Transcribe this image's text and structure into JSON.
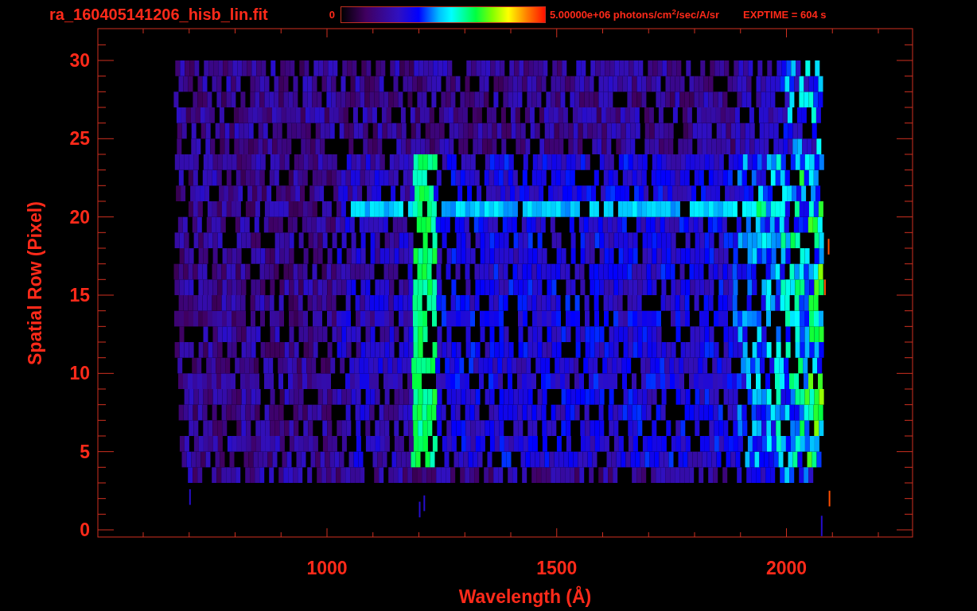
{
  "title": "ra_160405141206_hisb_lin.fit",
  "colorbar": {
    "min_label": "0",
    "max_label": "5.00000e+06 photons/cm$^{2}$/sec/A/sr"
  },
  "exposure": "EXPTIME = 604 s",
  "plot": {
    "xlabel": "Wavelength (Å)",
    "ylabel": "Spatial Row (Pixel)",
    "xtick_labels": [
      "1000",
      "1500",
      "2000"
    ],
    "ytick_labels": [
      "30",
      "25",
      "20",
      "15",
      "10",
      "5",
      "0"
    ]
  }
}
